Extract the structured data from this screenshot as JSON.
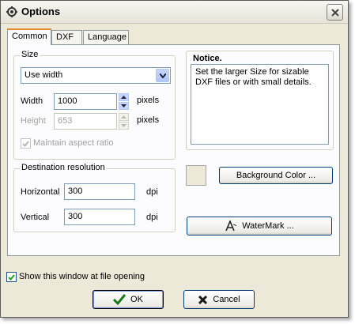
{
  "window": {
    "title": "Options"
  },
  "tabs": [
    {
      "label": "Common",
      "active": true
    },
    {
      "label": "DXF",
      "active": false
    },
    {
      "label": "Language",
      "active": false
    }
  ],
  "size_group": {
    "label": "Size",
    "mode_selected": "Use width",
    "width_label": "Width",
    "width_value": "1000",
    "width_unit": "pixels",
    "height_label": "Height",
    "height_value": "653",
    "height_unit": "pixels",
    "maintain_label": "Maintain aspect ratio",
    "maintain_checked": true
  },
  "notice": {
    "label": "Notice.",
    "text": "Set the larger Size for sizable\nDXF files or with small details."
  },
  "destination": {
    "label": "Destination resolution",
    "horizontal_label": "Horizontal",
    "horizontal_value": "300",
    "vertical_label": "Vertical",
    "vertical_value": "300",
    "unit": "dpi"
  },
  "buttons": {
    "background_color": "Background Color ...",
    "watermark": "WaterMark ...",
    "ok": "OK",
    "cancel": "Cancel"
  },
  "footer": {
    "show_at_open_label": "Show this window at file opening",
    "show_at_open_checked": true
  },
  "colors": {
    "ok_check": "#1a7a1a",
    "cancel_x": "#1a1a1a",
    "tab_accent": "#e68b2c"
  }
}
